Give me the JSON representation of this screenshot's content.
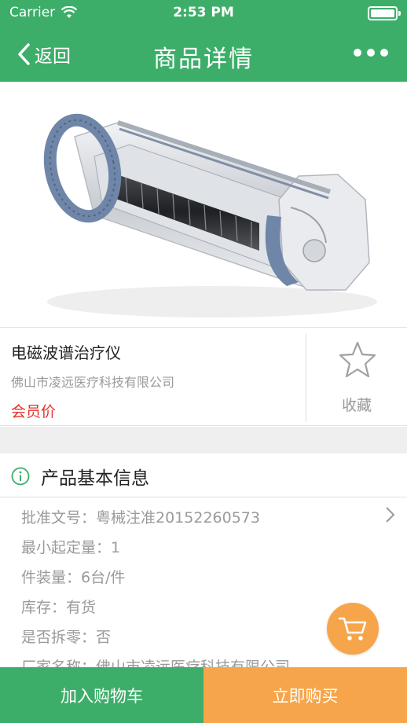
{
  "status_bar": {
    "carrier": "Carrier",
    "time": "2:53 PM"
  },
  "nav": {
    "back_label": "返回",
    "title": "商品详情"
  },
  "product": {
    "name": "电磁波谱治疗仪",
    "company": "佛山市凌远医疗科技有限公司",
    "price_label": "会员价",
    "favorite_label": "收藏"
  },
  "info": {
    "title": "产品基本信息",
    "rows": [
      "批准文号：粤械注准20152260573",
      "最小起定量：1",
      "件装量：6台/件",
      "库存：有货",
      "是否拆零：否",
      "厂家名称：佛山市凌远医疗科技有限公司"
    ]
  },
  "bottom": {
    "add_to_cart": "加入购物车",
    "buy_now": "立即购买"
  },
  "colors": {
    "primary": "#3dae69",
    "accent": "#f7a54a",
    "price": "#e5322d"
  },
  "icons": [
    "wifi-icon",
    "battery-icon",
    "back-chevron-icon",
    "more-icon",
    "star-icon",
    "info-circle-icon",
    "chevron-right-icon",
    "cart-icon"
  ]
}
